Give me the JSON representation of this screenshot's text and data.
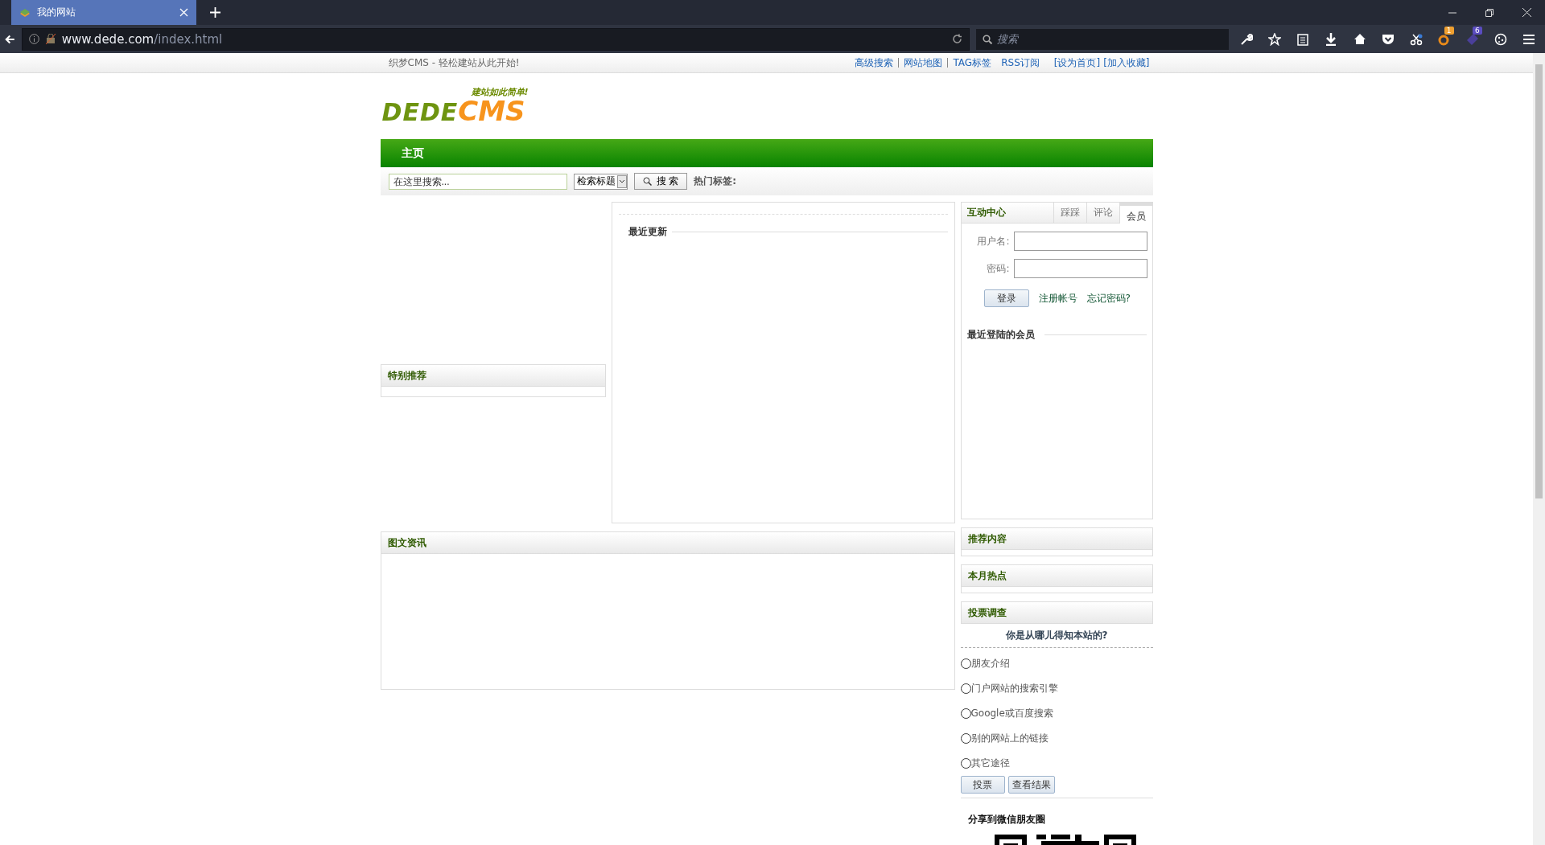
{
  "browser": {
    "tab_title": "我的网站",
    "url_host": "www.dede.com",
    "url_path": "/index.html",
    "search_placeholder": "搜索",
    "badges": [
      "1",
      "6"
    ]
  },
  "topbar": {
    "slogan": "织梦CMS - 轻松建站从此开始!",
    "links": [
      "高级搜索",
      "网站地图",
      "TAG标签",
      "RSS订阅"
    ],
    "bracket_links": [
      "[设为首页]",
      "[加入收藏]"
    ]
  },
  "logo": {
    "tagline": "建站如此简单!",
    "left": "DEDE",
    "right": "CMS"
  },
  "nav": [
    {
      "label": "主页",
      "selected": true
    }
  ],
  "search": {
    "placeholder": "在这里搜索...",
    "select_value": "检索标题",
    "button": "搜 索",
    "hot_tags_label": "热门标签:"
  },
  "left_panel": {
    "title": "特别推荐"
  },
  "middle_panel": {
    "title": "最近更新"
  },
  "picture_news": {
    "title": "图文资讯"
  },
  "member_box": {
    "title": "互动中心",
    "tabs": [
      {
        "label": "踩踩",
        "selected": false
      },
      {
        "label": "评论",
        "selected": false
      },
      {
        "label": "会员",
        "selected": true
      }
    ],
    "username_label": "用户名:",
    "password_label": "密码:",
    "login_button": "登录",
    "links": [
      "注册帐号",
      "忘记密码?"
    ],
    "recent_title": "最近登陆的会员"
  },
  "side_panels": [
    {
      "title": "推荐内容"
    },
    {
      "title": "本月热点"
    }
  ],
  "vote": {
    "title": "投票调查",
    "question": "你是从哪儿得知本站的?",
    "options": [
      {
        "label": "朋友介绍",
        "selected": false
      },
      {
        "label": "门户网站的搜索引擎",
        "selected": false
      },
      {
        "label": "Google或百度搜索",
        "selected": false
      },
      {
        "label": "别的网站上的链接",
        "selected": false
      },
      {
        "label": "其它途径",
        "selected": false
      }
    ],
    "buttons": [
      "投票",
      "查看结果"
    ]
  },
  "share": {
    "title": "分享到微信朋友圈"
  }
}
